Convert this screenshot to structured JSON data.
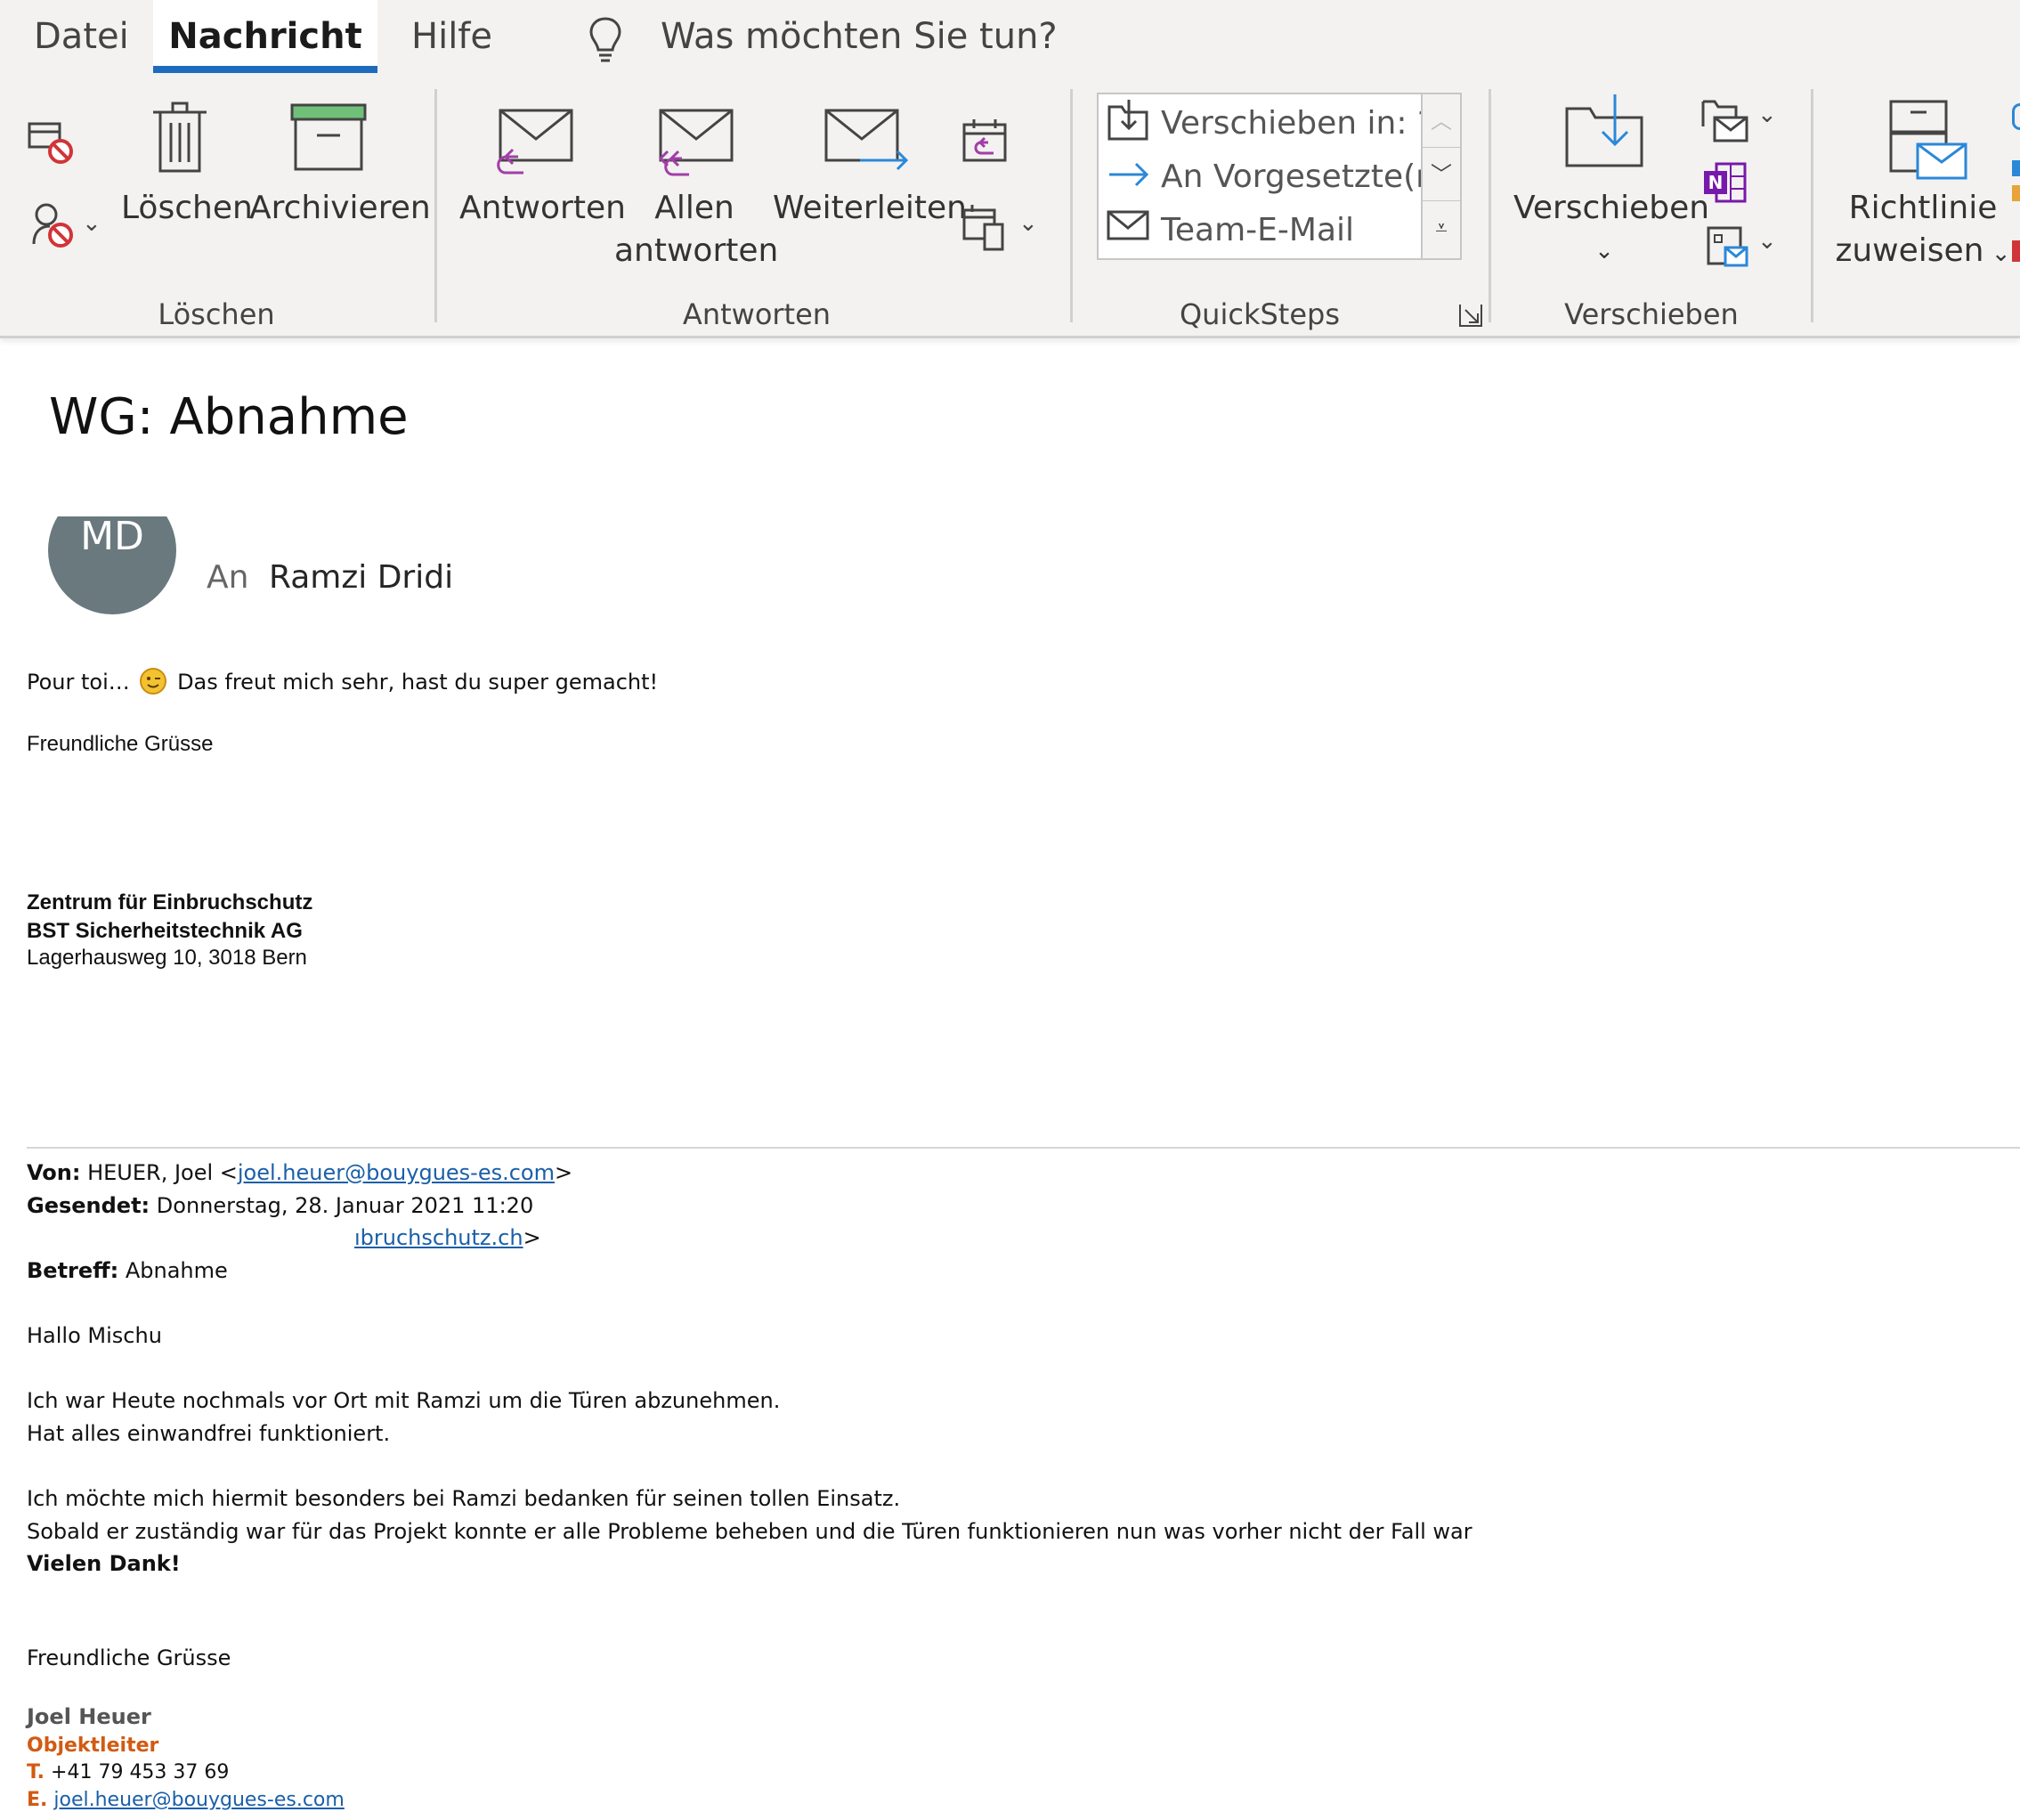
{
  "ribbon": {
    "tabs": {
      "datei": "Datei",
      "nachricht": "Nachricht",
      "hilfe": "Hilfe"
    },
    "tell_me": "Was möchten Sie tun?",
    "groups": {
      "loeschen": {
        "label": "Löschen",
        "delete": "Löschen",
        "archive": "Archivieren"
      },
      "antworten": {
        "label": "Antworten",
        "reply": "Antworten",
        "reply_all_line1": "Allen",
        "reply_all_line2": "antworten",
        "forward": "Weiterleiten"
      },
      "quicksteps": {
        "label": "QuickSteps",
        "items": [
          "Verschieben in: ?",
          "An Vorgesetzte(n)",
          "Team-E-Mail"
        ]
      },
      "verschieben": {
        "label": "Verschieben",
        "move": "Verschieben"
      },
      "tags": {
        "rule_line1": "Richtlinie",
        "rule_line2": "zuweisen"
      }
    },
    "colors": {
      "accent": "#1e6bbd",
      "purple": "#a23ea8",
      "blue": "#2b88d8",
      "onenote": "#7719aa",
      "green": "#70c07a"
    }
  },
  "message": {
    "subject": "WG: Abnahme",
    "avatar_initials": "MD",
    "to_label": "An",
    "to_name": "Ramzi Dridi",
    "intro_a": "Pour toi…",
    "intro_b": "Das freut mich sehr, hast du super gemacht!",
    "greeting": "Freundliche Grüsse",
    "sig": {
      "org1": "Zentrum für Einbruchschutz",
      "org2": "BST Sicherheitstechnik AG",
      "address": "Lagerhausweg 10, 3018 Bern"
    },
    "forward": {
      "from_label": "Von:",
      "from_name": "HEUER, Joel <",
      "from_email": "joel.heuer@bouygues-es.com",
      "from_close": ">",
      "sent_label": "Gesendet:",
      "sent_value": "Donnerstag, 28. Januar 2021 11:20",
      "to_partial_link": "ıbruchschutz.ch",
      "to_partial_close": ">",
      "subject_label": "Betreff:",
      "subject_value": "Abnahme",
      "salutation": "Hallo Mischu",
      "p1_l1": "Ich war Heute nochmals vor Ort mit Ramzi um die Türen abzunehmen.",
      "p1_l2": "Hat alles einwandfrei funktioniert.",
      "p2_l1": "Ich möchte mich hiermit besonders bei Ramzi bedanken für seinen tollen Einsatz.",
      "p2_l2": "Sobald er zuständig war für das Projekt konnte er alle Probleme beheben und die Türen funktionieren nun was vorher nicht der Fall war",
      "thanks": "Vielen Dank!",
      "greeting": "Freundliche Grüsse",
      "sig_name": "Joel Heuer",
      "sig_title": "Objektleiter",
      "sig_t_label": "T.",
      "sig_phone": "+41 79 453 37 69",
      "sig_e_label": "E.",
      "sig_email": "joel.heuer@bouygues-es.com"
    }
  }
}
